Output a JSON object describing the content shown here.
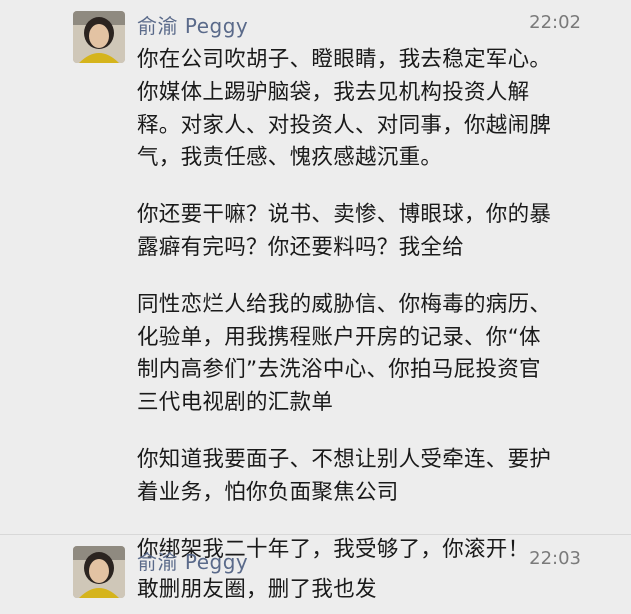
{
  "messages": [
    {
      "sender": "俞渝 Peggy",
      "time": "22:02",
      "paragraphs": [
        [
          "你在公司吹胡子、瞪眼睛，我去稳定军心。",
          "你媒体上踢驴脑袋，我去见机构投资人解",
          "释。对家人、对投资人、对同事，你越闹脾",
          "气，我责任感、愧疚感越沉重。"
        ],
        [
          "你还要干嘛？说书、卖惨、博眼球，你的暴",
          "露癖有完吗？你还要料吗？我全给"
        ],
        [
          "同性恋烂人给我的威胁信、你梅毒的病历、",
          "化验单，用我携程账户开房的记录、你“体",
          "制内高参们”去洗浴中心、你拍马屁投资官",
          "三代电视剧的汇款单"
        ],
        [
          "你知道我要面子、不想让别人受牵连、要护",
          "着业务，怕你负面聚焦公司"
        ],
        [
          "你绑架我二十年了，我受够了，你滚开！"
        ]
      ]
    },
    {
      "sender": "俞渝 Peggy",
      "time": "22:03",
      "paragraphs": [
        [
          "敢删朋友圈，删了我也发"
        ]
      ]
    }
  ]
}
